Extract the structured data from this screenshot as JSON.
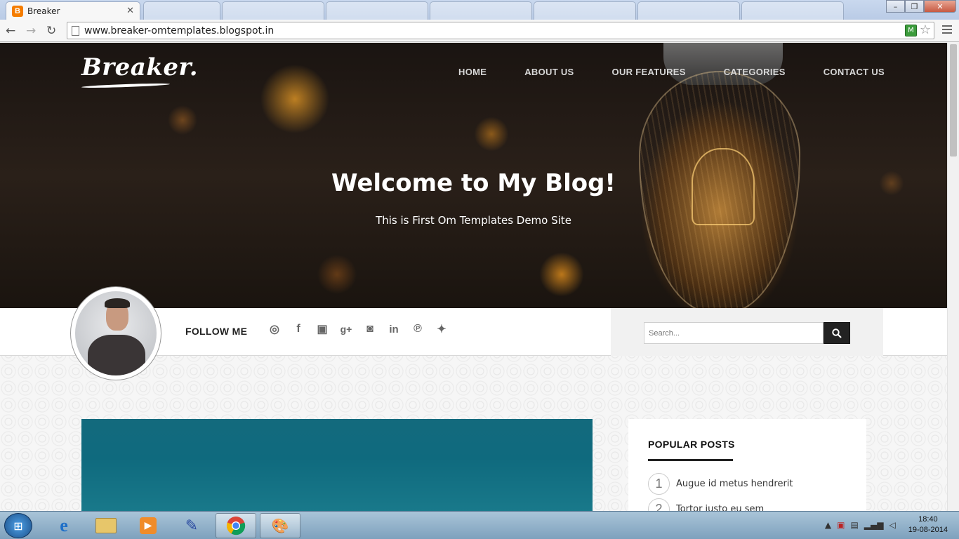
{
  "browser": {
    "active_tab": {
      "title": "Breaker",
      "favicon": "B"
    },
    "address": "www.breaker-omtemplates.blogspot.in"
  },
  "site": {
    "logo": "Breaker.",
    "nav": [
      "HOME",
      "ABOUT US",
      "OUR FEATURES",
      "CATEGORIES",
      "CONTACT US"
    ],
    "hero_title": "Welcome to My Blog!",
    "hero_subtitle": "This is First Om Templates Demo Site",
    "follow_label": "FOLLOW ME",
    "social_icons": [
      "dribbble-icon",
      "facebook-icon",
      "flickr-icon",
      "google-plus-icon",
      "instagram-icon",
      "linkedin-icon",
      "pinterest-icon",
      "twitter-icon"
    ],
    "search_placeholder": "Search...",
    "popular": {
      "title": "POPULAR POSTS",
      "items": [
        {
          "num": "1",
          "text": "Augue id metus hendrerit"
        },
        {
          "num": "2",
          "text": "Tortor justo eu sem"
        }
      ]
    }
  },
  "taskbar": {
    "time": "18:40",
    "date": "19-08-2014"
  },
  "colors": {
    "post_image": "#136a7d",
    "accent": "#222222"
  }
}
